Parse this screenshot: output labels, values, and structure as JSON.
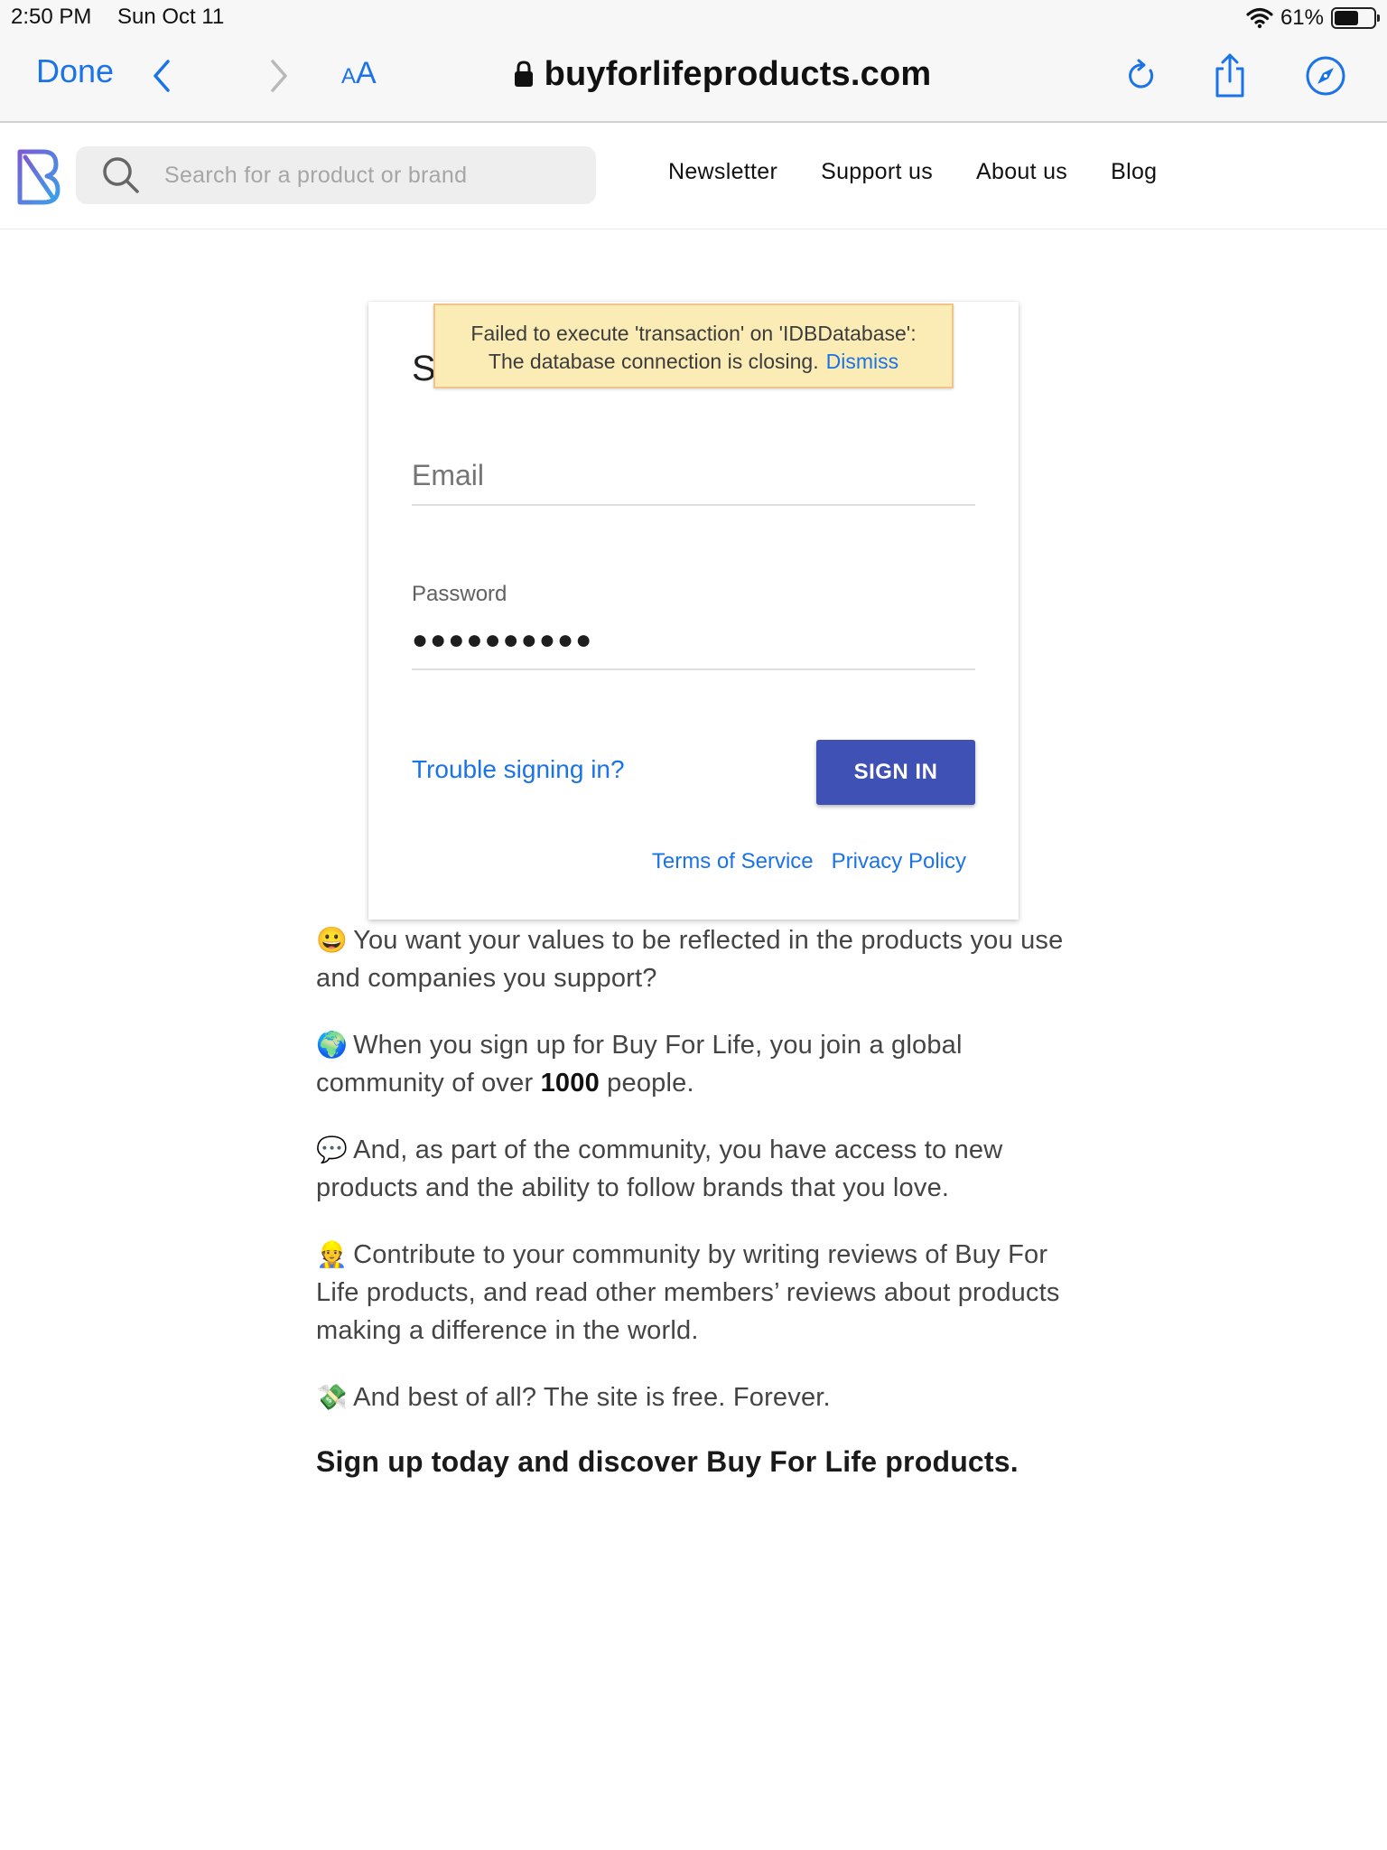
{
  "status_bar": {
    "time": "2:50 PM",
    "date": "Sun Oct 11",
    "battery": "61%",
    "battery_level": 0.61
  },
  "browser": {
    "done_label": "Done",
    "aa_small": "A",
    "aa_large": "A",
    "url": "buyforlifeproducts.com"
  },
  "site": {
    "search_placeholder": "Search for a product or brand",
    "nav": [
      "Newsletter",
      "Support us",
      "About us",
      "Blog"
    ]
  },
  "signin": {
    "title_fragment": "S",
    "error_line1": "Failed to execute 'transaction' on 'IDBDatabase':",
    "error_line2": "The database connection is closing.",
    "dismiss": "Dismiss",
    "email_placeholder": "Email",
    "password_label": "Password",
    "password_mask": "●●●●●●●●●●",
    "trouble": "Trouble signing in?",
    "button": "SIGN IN",
    "terms": "Terms of Service",
    "privacy": "Privacy Policy",
    "accent_color": "#3f51b5",
    "link_color": "#1a73e8"
  },
  "content": {
    "p1_emoji": "😀",
    "p1": "You want your values to be reflected in the products you use and companies you support?",
    "p2_emoji": "🌍",
    "p2_before": "When you sign up for Buy For Life, you join a global community of over ",
    "p2_bold": "1000",
    "p2_after": " people.",
    "p3_emoji": "💬",
    "p3": "And, as part of the community, you have access to new products and the ability to follow brands that you love.",
    "p4_emoji": "👷",
    "p4": "Contribute to your community by writing reviews of Buy For Life products, and read other members’ reviews about products making a difference in the world.",
    "p5_emoji": "💸",
    "p5": "And best of all? The site is free. Forever.",
    "cta": "Sign up today and discover Buy For Life products."
  }
}
